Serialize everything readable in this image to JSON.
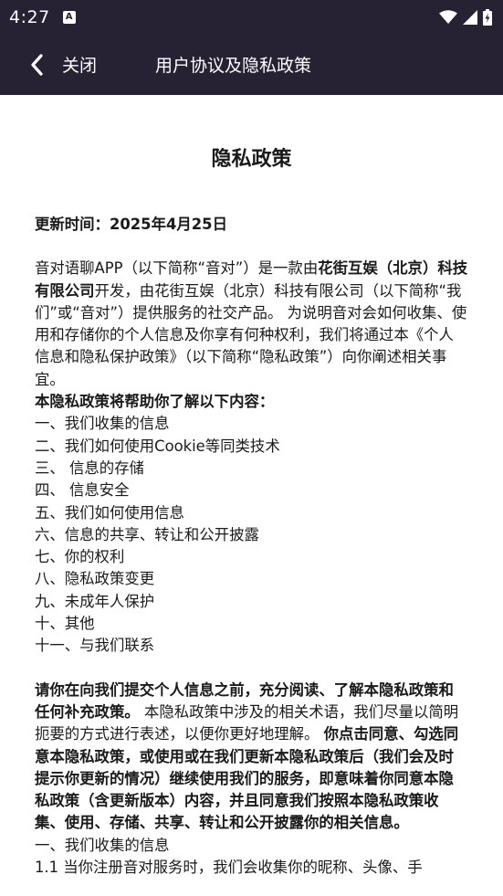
{
  "status_bar": {
    "time": "4:27",
    "notification_glyph": "A"
  },
  "nav": {
    "back_icon": "chevron-left-icon",
    "close_label": "关闭",
    "title": "用户协议及隐私政策"
  },
  "doc": {
    "title": "隐私政策",
    "update_time": "更新时间：2025年4月25日",
    "intro": {
      "p1": "音对语聊APP（以下简称“音对”）是一款由",
      "company_bold": "花街互娱（北京）科技有限公司",
      "p2": "开发，由花街互娱（北京）科技有限公司（以下简称“我们”或“音对”）提供服务的社交产品。 为说明音对会如何收集、使用和存储你的个人信息及你享有何种权利，我们将通过本《个人信息和隐私保护政策》（以下简称“隐私政策”）向你阐述相关事宜。"
    },
    "toc_heading": "本隐私政策将帮助你了解以下内容：",
    "toc": [
      "一、我们收集的信息",
      "二、我们如何使用Cookie等同类技术",
      "三、 信息的存储",
      "四、 信息安全",
      "五、我们如何使用信息",
      "六、信息的共享、转让和公开披露",
      "七、你的权利",
      "八、隐私政策变更",
      "九、未成年人保护",
      "十、其他",
      "十一、与我们联系"
    ],
    "notice": {
      "bold1": "请你在向我们提交个人信息之前，充分阅读、了解本隐私政策和任何补充政策。",
      "normal": " 本隐私政策中涉及的相关术语，我们尽量以简明扼要的方式进行表述，以便你更好地理解。 ",
      "bold2": "你点击同意、勾选同意本隐私政策，或使用或在我们更新本隐私政策后（我们会及时提示你更新的情况）继续使用我们的服务，即意味着你同意本隐私政策（含更新版本）内容，并且同意我们按照本隐私政策收集、使用、存储、共享、转让和公开披露你的相关信息。"
    },
    "section1_heading": "一、我们收集的信息",
    "section1_first": "1.1 当你注册音对服务时，我们会收集你的昵称、头像、手"
  }
}
